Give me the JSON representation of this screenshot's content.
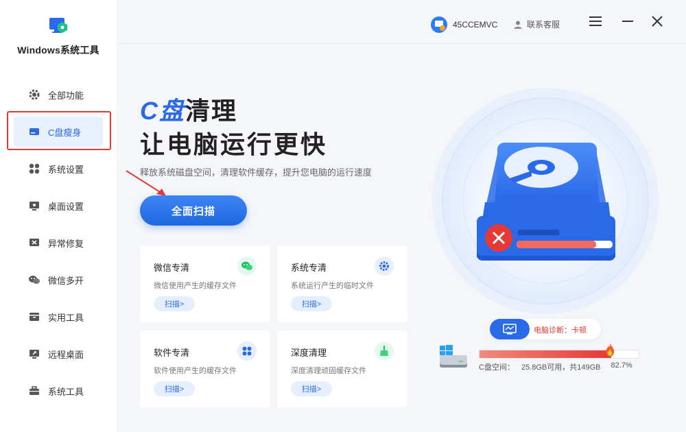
{
  "app": {
    "title": "Windows系统工具"
  },
  "sidebar": {
    "items": [
      {
        "label": "全部功能",
        "icon": "gear-icon"
      },
      {
        "label": "C盘瘦身",
        "icon": "drive-icon",
        "active": true
      },
      {
        "label": "系统设置",
        "icon": "grid-icon"
      },
      {
        "label": "桌面设置",
        "icon": "monitor-icon"
      },
      {
        "label": "异常修复",
        "icon": "repair-icon"
      },
      {
        "label": "微信多开",
        "icon": "wechat-icon"
      },
      {
        "label": "实用工具",
        "icon": "box-icon"
      },
      {
        "label": "远程桌面",
        "icon": "remote-icon"
      },
      {
        "label": "系统工具",
        "icon": "toolbox-icon"
      }
    ]
  },
  "header": {
    "username": "45CCEMVC",
    "service_label": "联系客服"
  },
  "hero": {
    "title_accent": "C盘",
    "title_rest": "清理",
    "title_line2": "让电脑运行更快",
    "subtitle": "释放系统磁盘空间，清理软件缓存，提升您电脑的运行速度",
    "scan_button": "全面扫描"
  },
  "cards": [
    {
      "title": "微信专清",
      "desc": "微信使用产生的缓存文件",
      "button": "扫描>",
      "icon": "wechat-icon"
    },
    {
      "title": "系统专清",
      "desc": "系统运行产生的临时文件",
      "button": "扫描>",
      "icon": "gear-icon"
    },
    {
      "title": "软件专清",
      "desc": "软件使用产生的缓存文件",
      "button": "扫描>",
      "icon": "apps-icon"
    },
    {
      "title": "深度清理",
      "desc": "深度清理顽固缓存文件",
      "button": "扫描>",
      "icon": "broom-icon"
    }
  ],
  "diagnosis": {
    "label": "电脑诊断：卡顿"
  },
  "disk": {
    "label": "C盘空间：",
    "available": "25.8GB可用，共149GB",
    "percent_text": "82.7%",
    "used_fraction": 0.827
  },
  "colors": {
    "accent": "#2a6ae9",
    "danger": "#e53935"
  }
}
